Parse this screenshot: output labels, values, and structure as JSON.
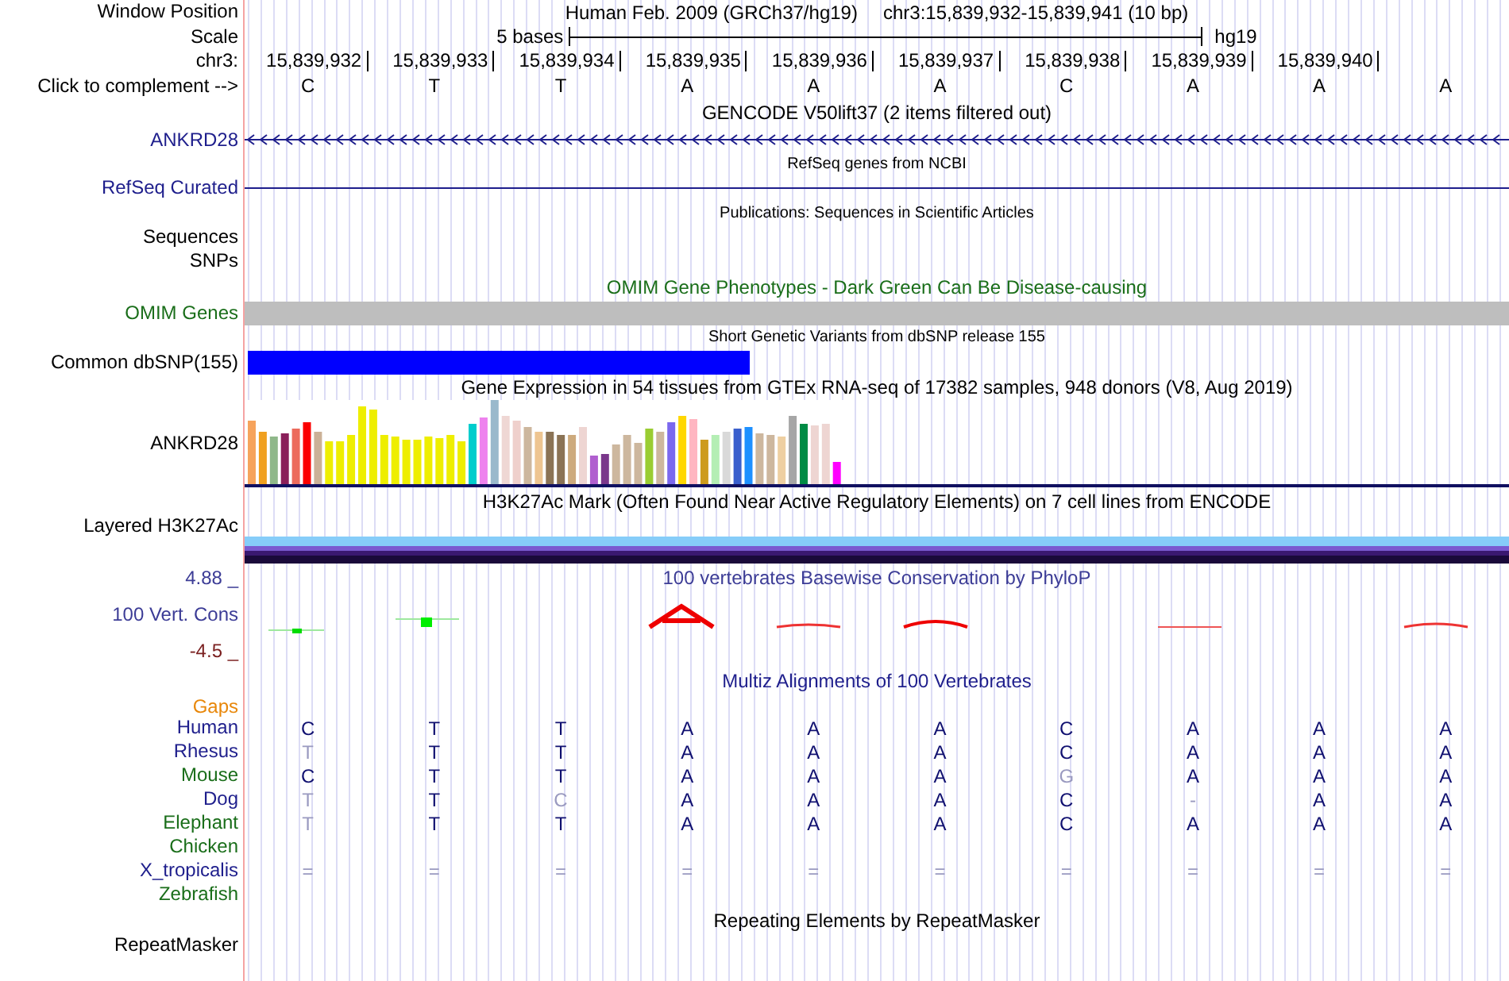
{
  "header": {
    "window_position_label": "Window Position",
    "assembly": "Human Feb. 2009 (GRCh37/hg19)",
    "position": "chr3:15,839,932-15,839,941 (10 bp)",
    "scale_label": "Scale",
    "scale_text": "5 bases",
    "scale_db": "hg19",
    "chrom_label": "chr3:",
    "positions": [
      "15,839,932",
      "15,839,933",
      "15,839,934",
      "15,839,935",
      "15,839,936",
      "15,839,937",
      "15,839,938",
      "15,839,939",
      "15,839,940"
    ],
    "complement_label": "Click to complement -->",
    "bases": [
      "C",
      "T",
      "T",
      "A",
      "A",
      "A",
      "C",
      "A",
      "A",
      "A"
    ]
  },
  "gencode": {
    "title": "GENCODE V50lift37 (2 items filtered out)",
    "label": "ANKRD28",
    "color": "#1e1e8c"
  },
  "refseq": {
    "title": "RefSeq genes from NCBI",
    "label": "RefSeq Curated",
    "color": "#1e1e8c"
  },
  "publications": {
    "title": "Publications: Sequences in Scientific Articles",
    "labels": [
      "Sequences",
      "SNPs"
    ],
    "color": "#000000"
  },
  "omim": {
    "title": "OMIM Gene Phenotypes - Dark Green Can Be Disease-causing",
    "label": "OMIM Genes",
    "color": "#1a6e1a"
  },
  "dbsnp": {
    "title": "Short Genetic Variants from dbSNP release 155",
    "label": "Common dbSNP(155)",
    "color": "#000000"
  },
  "gtex": {
    "title": "Gene Expression in 54 tissues from GTEx RNA-seq of 17382 samples, 948 donors (V8, Aug 2019)",
    "label": "ANKRD28",
    "color": "#000000"
  },
  "h3k27ac": {
    "title": "H3K27Ac Mark (Often Found Near Active Regulatory Elements) on 7 cell lines from ENCODE",
    "label": "Layered H3K27Ac",
    "color": "#000000"
  },
  "conservation": {
    "title": "100 vertebrates Basewise Conservation by PhyloP",
    "label": "100 Vert. Cons",
    "max": "4.88 _",
    "min": "-4.5 _",
    "color": "#3c3c96"
  },
  "multiz": {
    "title": "Multiz Alignments of 100 Vertebrates",
    "gaps_label": "Gaps",
    "species": [
      {
        "name": "Human",
        "color": "#1e1e8c",
        "bases": [
          "C",
          "T",
          "T",
          "A",
          "A",
          "A",
          "C",
          "A",
          "A",
          "A"
        ],
        "faint": [
          false,
          false,
          false,
          false,
          false,
          false,
          false,
          false,
          false,
          false
        ]
      },
      {
        "name": "Rhesus",
        "color": "#1e1e8c",
        "bases": [
          "T",
          "T",
          "T",
          "A",
          "A",
          "A",
          "C",
          "A",
          "A",
          "A"
        ],
        "faint": [
          true,
          false,
          false,
          false,
          false,
          false,
          false,
          false,
          false,
          false
        ]
      },
      {
        "name": "Mouse",
        "color": "#1a6e1a",
        "bases": [
          "C",
          "T",
          "T",
          "A",
          "A",
          "A",
          "G",
          "A",
          "A",
          "A"
        ],
        "faint": [
          false,
          false,
          false,
          false,
          false,
          false,
          true,
          false,
          false,
          false
        ]
      },
      {
        "name": "Dog",
        "color": "#1e1e8c",
        "bases": [
          "T",
          "T",
          "C",
          "A",
          "A",
          "A",
          "C",
          "-",
          "A",
          "A"
        ],
        "faint": [
          true,
          false,
          true,
          false,
          false,
          false,
          false,
          true,
          false,
          false
        ]
      },
      {
        "name": "Elephant",
        "color": "#1a6e1a",
        "bases": [
          "T",
          "T",
          "T",
          "A",
          "A",
          "A",
          "C",
          "A",
          "A",
          "A"
        ],
        "faint": [
          true,
          false,
          false,
          false,
          false,
          false,
          false,
          false,
          false,
          false
        ]
      },
      {
        "name": "Chicken",
        "color": "#1a6e1a"
      },
      {
        "name": "X_tropicalis",
        "color": "#1e1e8c",
        "bases": [
          "=",
          "=",
          "=",
          "=",
          "=",
          "=",
          "=",
          "=",
          "=",
          "="
        ],
        "faint": [
          true,
          true,
          true,
          true,
          true,
          true,
          true,
          true,
          true,
          true
        ]
      },
      {
        "name": "Zebrafish",
        "color": "#1a6e1a"
      }
    ]
  },
  "repeats": {
    "title": "Repeating Elements by RepeatMasker",
    "label": "RepeatMasker",
    "color": "#000000"
  }
}
